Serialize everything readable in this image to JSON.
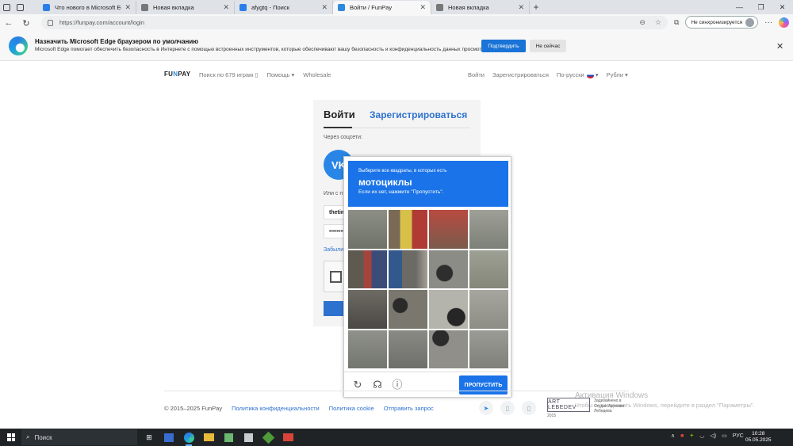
{
  "browser": {
    "tabs": [
      {
        "label": "Что нового в Microsoft Edge",
        "color": "#2a7ee8"
      },
      {
        "label": "Новая вкладка",
        "color": "#777777"
      },
      {
        "label": "afygtq - Поиск",
        "color": "#2a7ee8"
      },
      {
        "label": "Войти / FunPay",
        "color": "#2c89e0"
      },
      {
        "label": "Новая вкладка",
        "color": "#777777"
      }
    ],
    "new_tab": "+",
    "url": "https://funpay.com/account/login",
    "sync_label": "Не синхронизируется"
  },
  "infobar": {
    "title": "Назначить Microsoft Edge браузером по умолчанию",
    "subtitle": "Microsoft Edge помогает обеспечить безопасность в Интернете с помощью встроенных инструментов, которые обеспечивают вашу безопасность и конфиденциальность данных просмотра",
    "confirm": "Подтвердить",
    "later": "Не сейчас"
  },
  "site": {
    "logo_a": "FU",
    "logo_b": "N",
    "logo_c": "PAY",
    "search": "Поиск по 679 играм",
    "help": "Помощь",
    "wholesale": "Wholesale",
    "login": "Войти",
    "register": "Зарегистрироваться",
    "language": "По-русски",
    "currency": "Рубли"
  },
  "login_card": {
    "tab_login": "Войти",
    "tab_register": "Зарегистрироваться",
    "social_label": "Через соцсети:",
    "vk": "VK",
    "or_label": "Или с п",
    "username_value": "thetim",
    "password_value": "••••••••",
    "forgot": "Забыли"
  },
  "captcha": {
    "instruction": "Выберите все квадраты, в которых есть",
    "object": "мотоциклы",
    "hint": "Если их нет, нажмите \"Пропустить\".",
    "skip": "ПРОПУСТИТЬ"
  },
  "footer": {
    "copyright": "© 2015–2025 FunPay",
    "privacy": "Политика конфиденциальности",
    "cookie": "Политика cookie",
    "report": "Отправить запрос",
    "art_badge": "ART LEBEDEV",
    "art_year": "2015",
    "art_text": "Задизайнено в Студии Артемия Лебедева"
  },
  "watermark": {
    "line1": "Активация Windows",
    "line2": "Чтобы активировать Windows, перейдите в раздел \"Параметры\"."
  },
  "taskbar": {
    "search": "Поиск",
    "lang": "РУС",
    "time": "10:28",
    "date": "05.05.2025"
  }
}
